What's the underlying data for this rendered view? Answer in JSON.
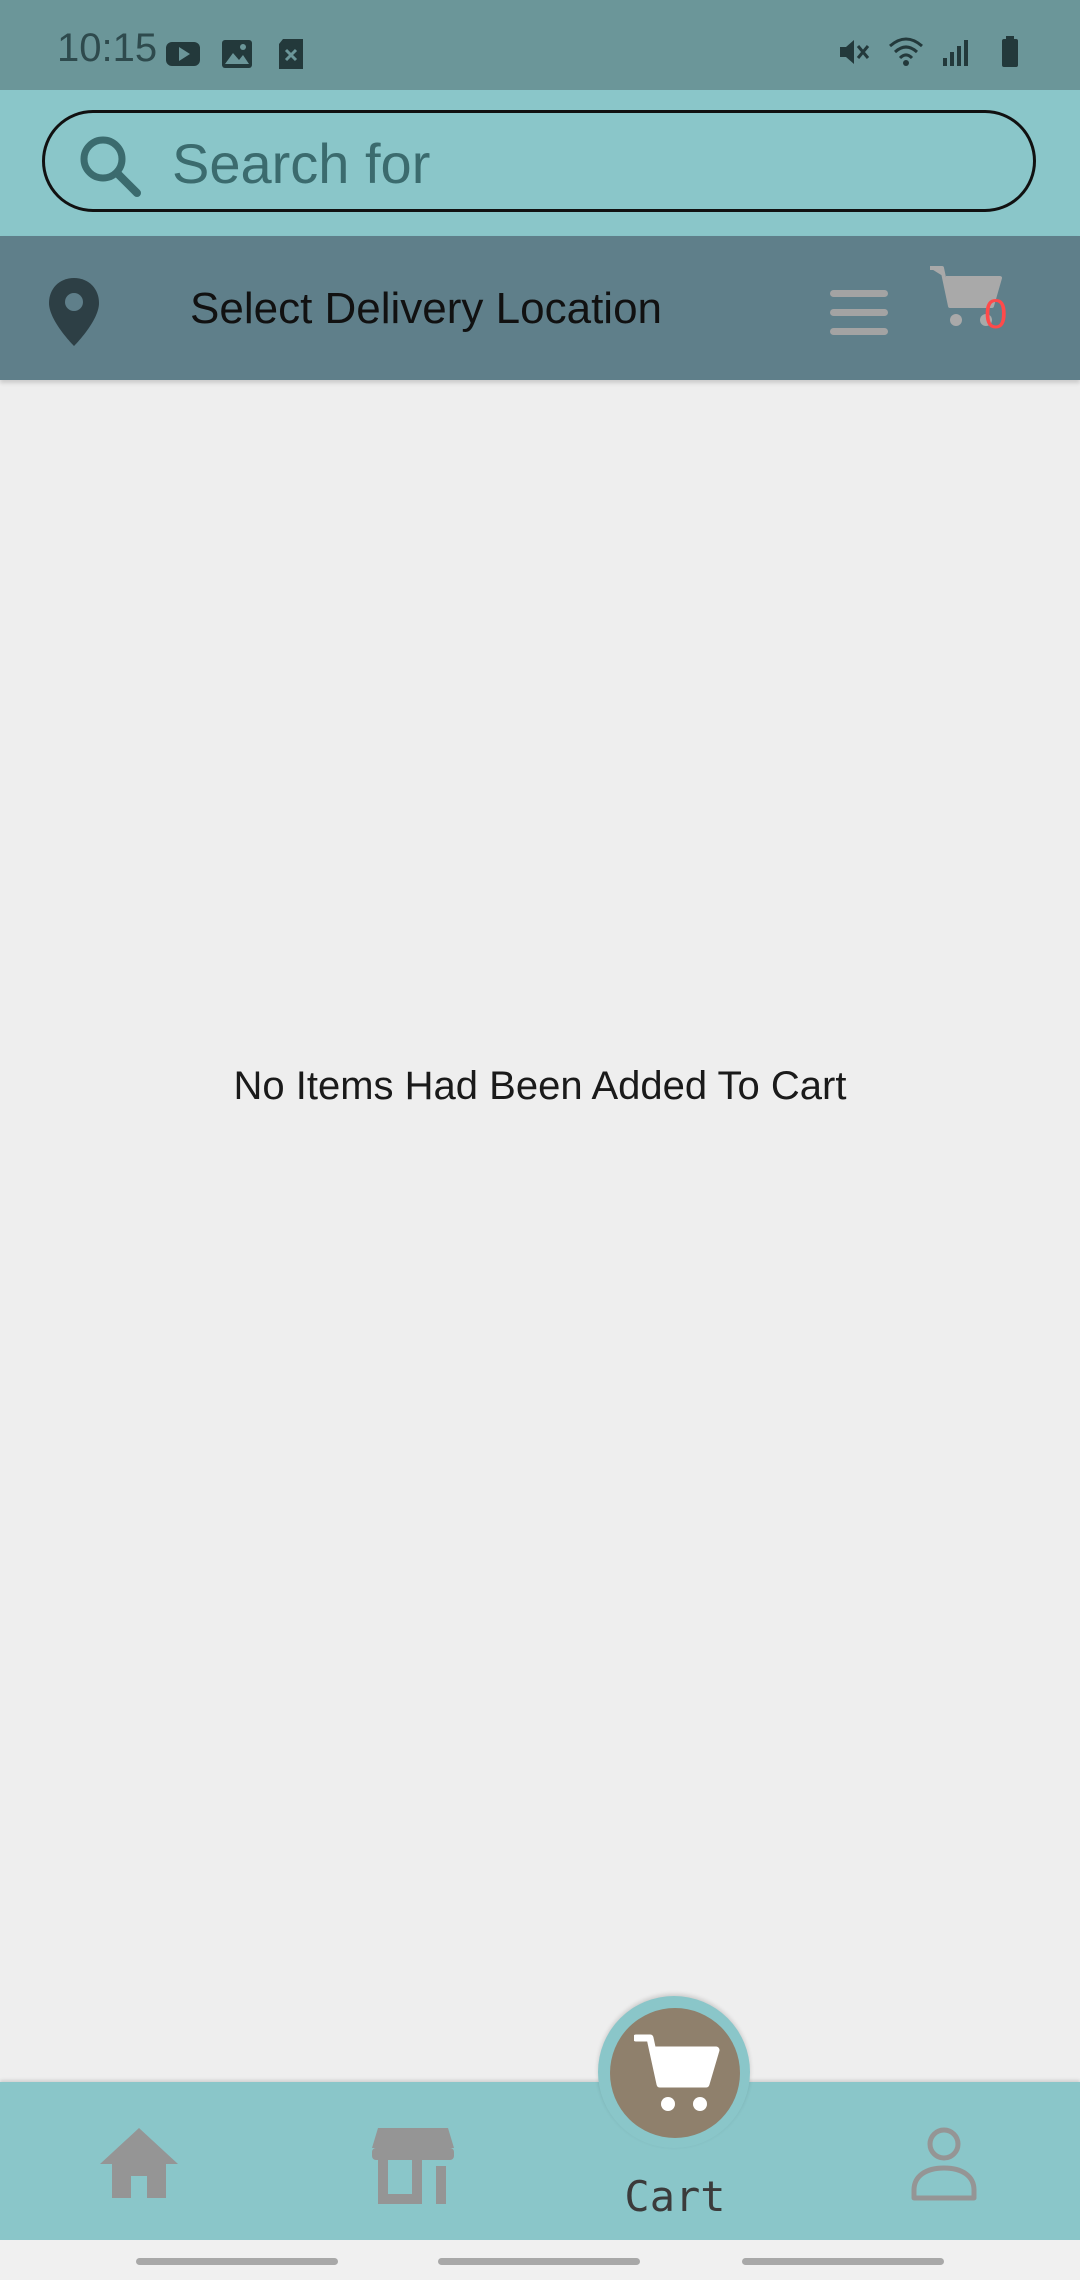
{
  "status_bar": {
    "time": "10:15",
    "left_icons": [
      "youtube-icon",
      "image-icon",
      "sd-card-icon"
    ],
    "right_icons": [
      "mute-icon",
      "wifi-icon",
      "signal-icon",
      "battery-icon"
    ]
  },
  "search": {
    "placeholder": "Search for",
    "value": ""
  },
  "location_bar": {
    "label": "Select Delivery Location",
    "cart_count": "0"
  },
  "main": {
    "empty_message": "No Items Had Been Added To Cart"
  },
  "bottom_nav": {
    "items": [
      "home-icon",
      "store-icon",
      "cart-icon",
      "profile-icon"
    ],
    "active_label": "Cart"
  },
  "colors": {
    "status_bar": "#6b9699",
    "accent": "#8ac6c9",
    "location_bar": "#5f7f8a",
    "fab": "#8f806c",
    "cart_badge": "#ff4a4a",
    "background": "#eeeeee"
  }
}
